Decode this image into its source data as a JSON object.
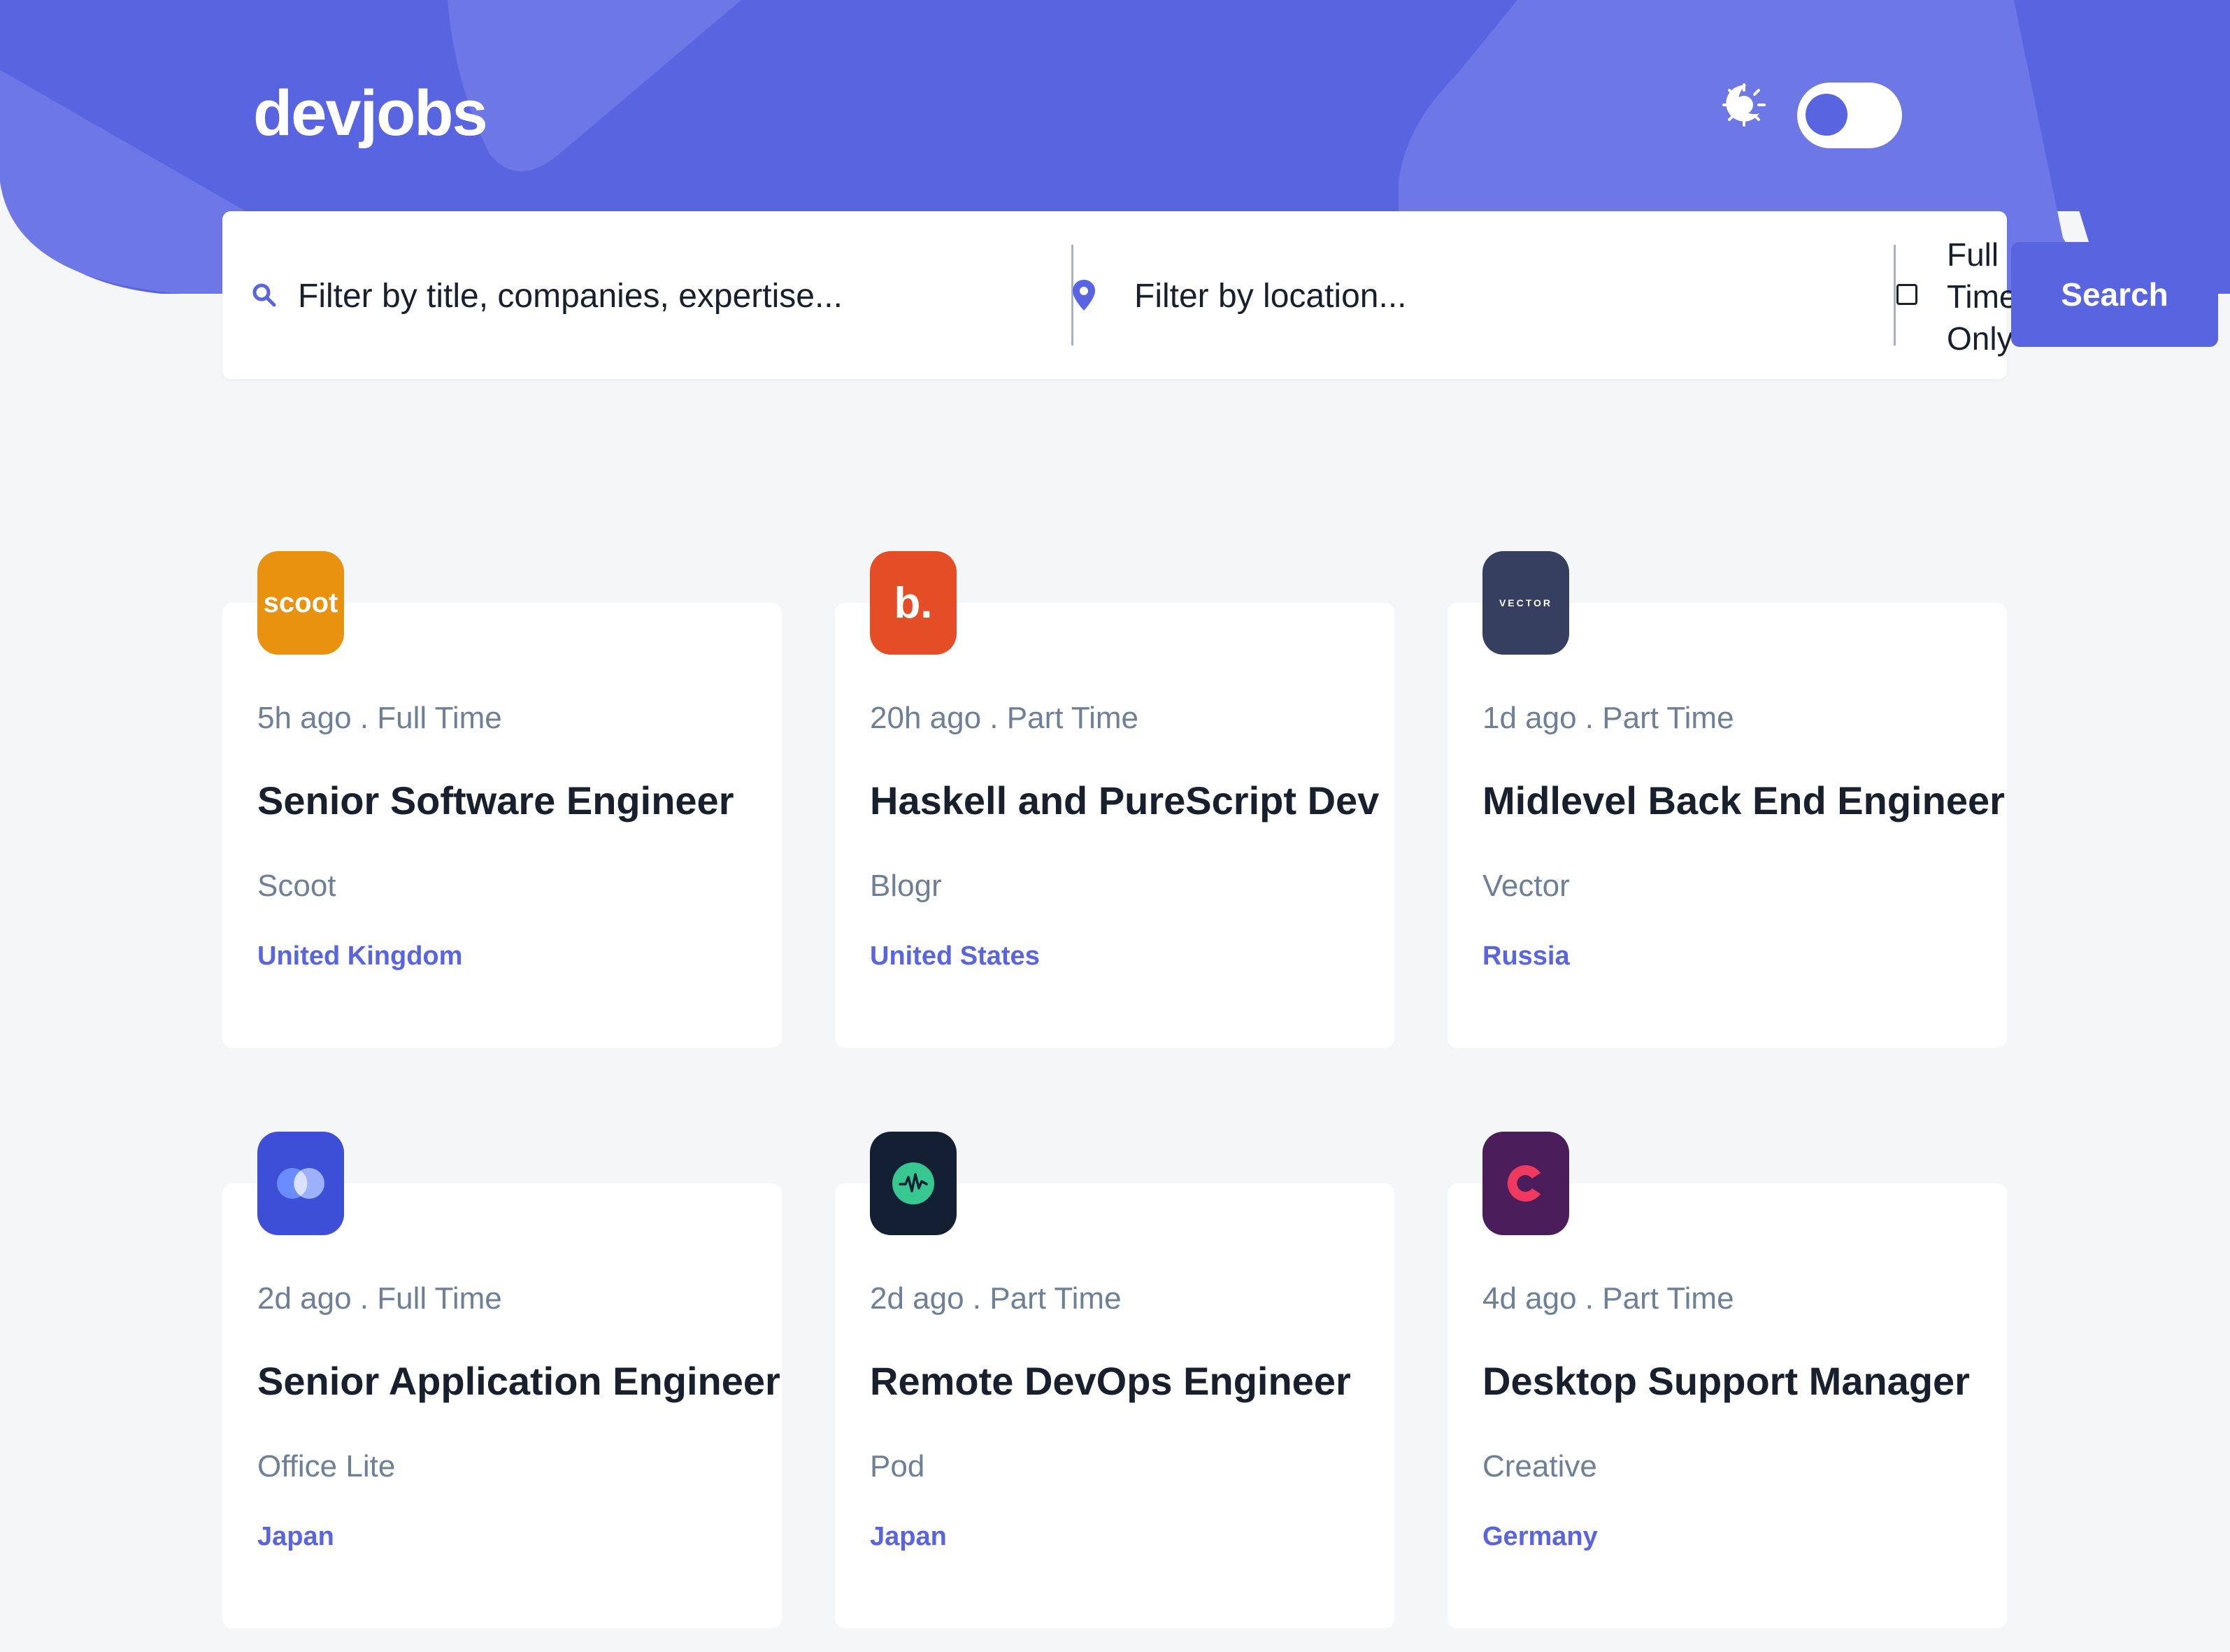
{
  "app": {
    "logo": "devjobs"
  },
  "theme": {
    "mode": "light",
    "accent_color": "#5964e0",
    "sun_icon": "sun-icon",
    "moon_icon": "moon-icon"
  },
  "search": {
    "title_placeholder": "Filter by title, companies, expertise...",
    "title_value": "",
    "location_placeholder": "Filter by location...",
    "location_value": "",
    "fulltime_label": "Full Time Only",
    "fulltime_checked": false,
    "button_label": "Search"
  },
  "jobs": [
    {
      "posted": "5h ago",
      "contract": "Full Time",
      "title": "Senior Software Engineer",
      "company": "Scoot",
      "location": "United Kingdom",
      "logo_text": "scoot",
      "logo_bg": "#e99210"
    },
    {
      "posted": "20h ago",
      "contract": "Part Time",
      "title": "Haskell and PureScript Dev",
      "company": "Blogr",
      "location": "United States",
      "logo_text": "b.",
      "logo_bg": "#e54d26"
    },
    {
      "posted": "1d ago",
      "contract": "Part Time",
      "title": "Midlevel Back End Engineer",
      "company": "Vector",
      "location": "Russia",
      "logo_text": "VECTOR",
      "logo_bg": "#363f5f"
    },
    {
      "posted": "2d ago",
      "contract": "Full Time",
      "title": "Senior Application Engineer",
      "company": "Office Lite",
      "location": "Japan",
      "logo_text": "",
      "logo_bg": "#4e3be5"
    },
    {
      "posted": "2d ago",
      "contract": "Part Time",
      "title": "Remote DevOps Engineer",
      "company": "Pod",
      "location": "Japan",
      "logo_text": "",
      "logo_bg": "#132034"
    },
    {
      "posted": "4d ago",
      "contract": "Part Time",
      "title": "Desktop Support Manager",
      "company": "Creative",
      "location": "Germany",
      "logo_text": "",
      "logo_bg": "#4b1d5a"
    }
  ]
}
